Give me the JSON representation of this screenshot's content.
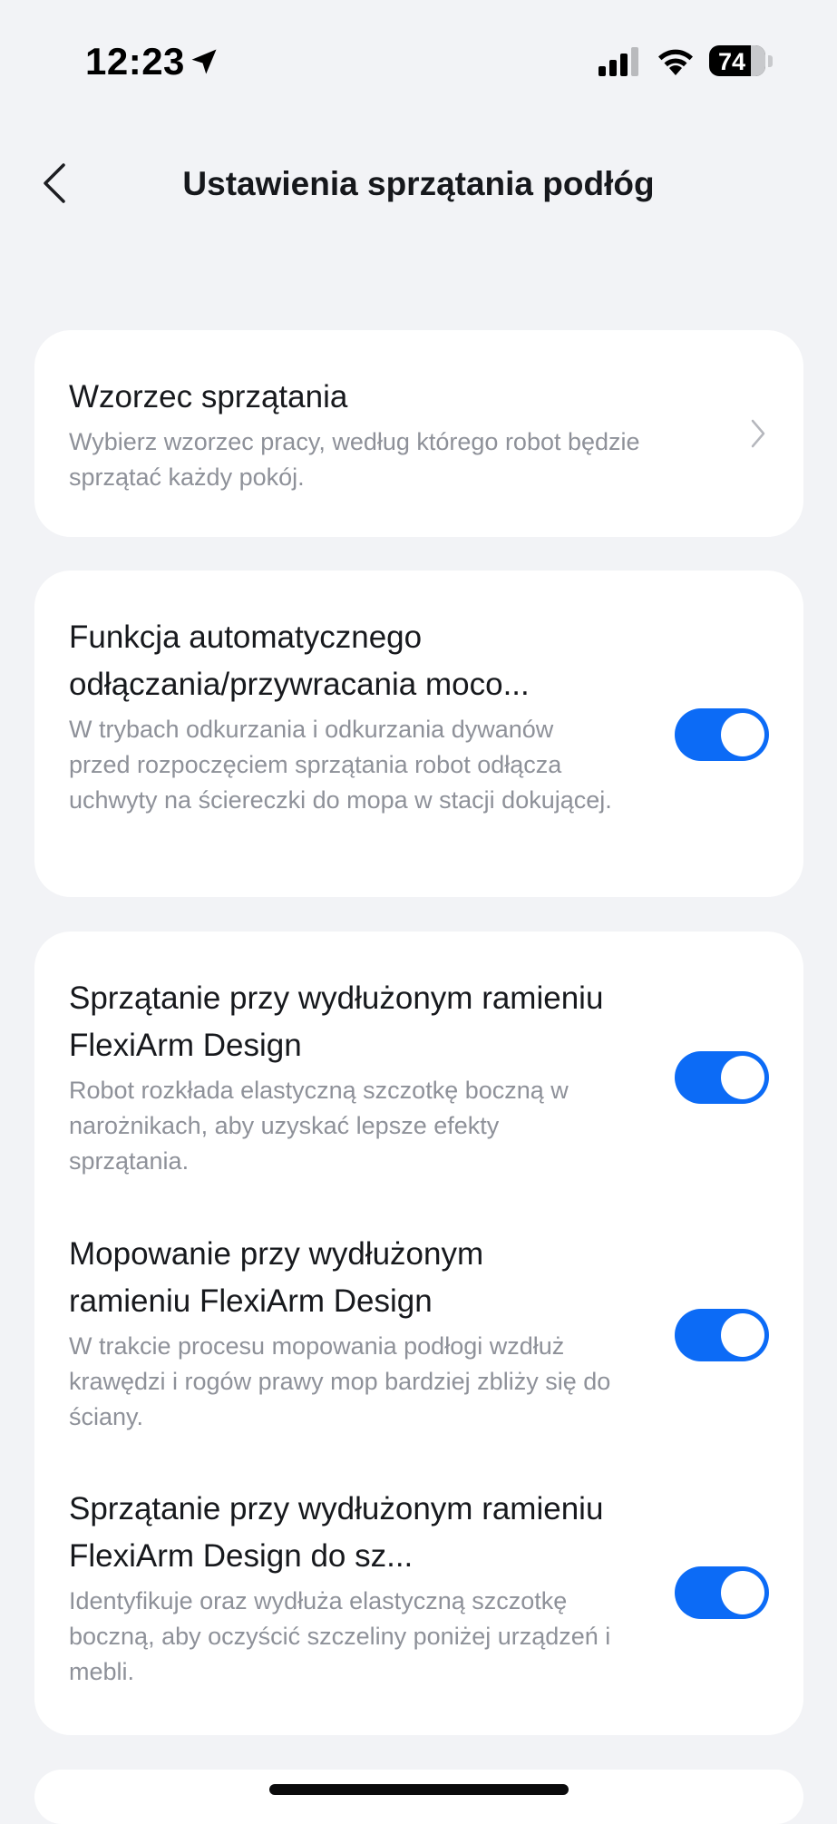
{
  "status_bar": {
    "time": "12:23",
    "battery": "74"
  },
  "header": {
    "title": "Ustawienia sprzątania podłóg",
    "back_icon": "back-chevron-icon"
  },
  "settings": {
    "pattern": {
      "title": "Wzorzec sprzątania",
      "desc": "Wybierz wzorzec pracy, według którego robot będzie sprzątać każdy pokój."
    },
    "mop_detach": {
      "title": "Funkcja automatycznego odłączania/przywracania moco...",
      "desc": "W trybach odkurzania i odkurzania dywanów przed rozpoczęciem sprzątania robot odłącza uchwyty na ściereczki do mopa w stacji dokującej.",
      "enabled": true
    },
    "flexiarm_clean": {
      "title": "Sprzątanie przy wydłużonym ramieniu FlexiArm Design",
      "desc": "Robot rozkłada elastyczną szczotkę boczną w narożnikach, aby uzyskać lepsze efekty sprzątania.",
      "enabled": true
    },
    "flexiarm_mop": {
      "title": "Mopowanie przy wydłużonym ramieniu FlexiArm Design",
      "desc": "W trakcie procesu mopowania podłogi wzdłuż krawędzi i rogów prawy mop bardziej zbliży się do ściany.",
      "enabled": true
    },
    "flexiarm_gaps": {
      "title": "Sprzątanie przy wydłużonym ramieniu FlexiArm Design do sz...",
      "desc": "Identyfikuje oraz wydłuża elastyczną szczotkę boczną, aby oczyścić szczeliny poniżej urządzeń i mebli.",
      "enabled": true
    }
  },
  "colors": {
    "accent": "#0c6bf6",
    "background": "#f2f3f6",
    "card": "#ffffff",
    "secondary_text": "#8e9199"
  }
}
